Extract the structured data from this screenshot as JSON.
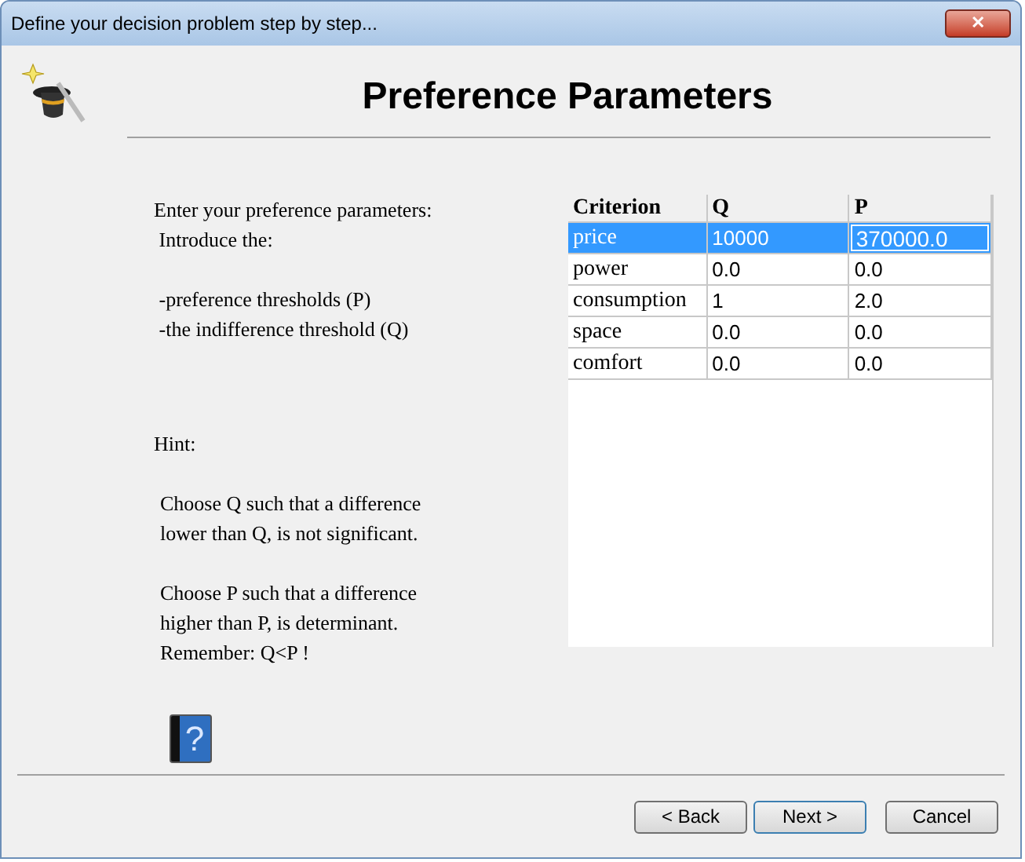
{
  "window": {
    "title": "Define your decision problem step by step...",
    "close": "✕"
  },
  "heading": "Preference Parameters",
  "instructions": [
    [
      "Enter your preference parameters:",
      " Introduce the:"
    ],
    [
      " -preference thresholds (P)",
      " -the indifference threshold (Q)"
    ]
  ],
  "hint": {
    "label": "Hint:",
    "paragraphs": [
      [
        "Choose Q such that a difference",
        "lower than Q, is not significant."
      ],
      [
        "Choose P such that a difference",
        "higher than P, is determinant.",
        "Remember: Q<P !"
      ]
    ]
  },
  "help": {
    "glyph": "?"
  },
  "table": {
    "columns": [
      "Criterion",
      "Q",
      "P"
    ],
    "rows": [
      {
        "cells": [
          "price",
          "10000",
          "370000.0"
        ],
        "selected": true,
        "editing": true
      },
      {
        "cells": [
          "power",
          "0.0",
          "0.0"
        ],
        "selected": false,
        "editing": false
      },
      {
        "cells": [
          "consumption",
          "1",
          "2.0"
        ],
        "selected": false,
        "editing": false
      },
      {
        "cells": [
          "space",
          "0.0",
          "0.0"
        ],
        "selected": false,
        "editing": false
      },
      {
        "cells": [
          "comfort",
          "0.0",
          "0.0"
        ],
        "selected": false,
        "editing": false
      }
    ]
  },
  "buttons": [
    {
      "label": "< Back",
      "default": false
    },
    {
      "label": "Next >",
      "default": true
    },
    {
      "label": "Cancel",
      "default": false
    }
  ]
}
